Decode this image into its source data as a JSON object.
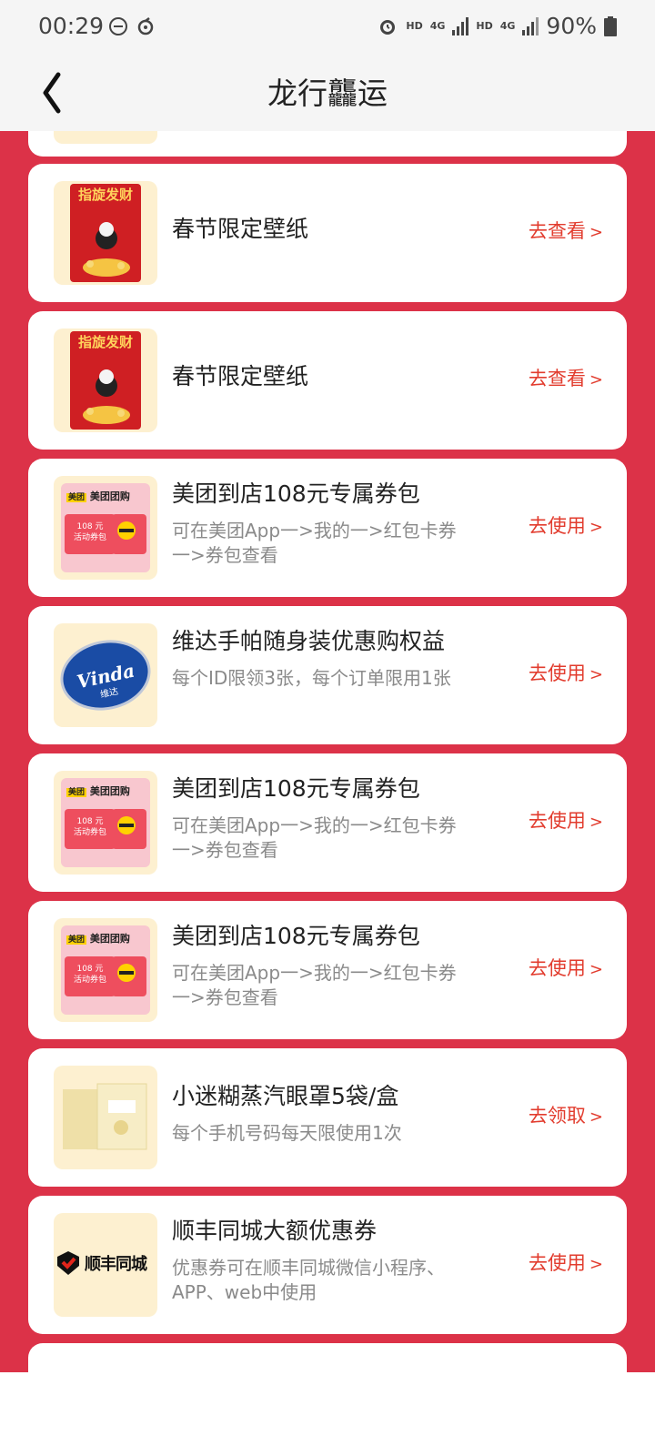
{
  "status_bar": {
    "time": "00:29",
    "network_1": "4G",
    "network_2": "4G",
    "battery": "90%"
  },
  "nav": {
    "title": "龙行龘运"
  },
  "items": [
    {
      "thumb": "red-envelope",
      "envelope_text": "指旋发财",
      "title": "春节限定壁纸",
      "desc": "",
      "action": "去查看",
      "arrow": ">"
    },
    {
      "thumb": "red-envelope",
      "envelope_text": "指旋发财",
      "title": "春节限定壁纸",
      "desc": "",
      "action": "去查看",
      "arrow": ">"
    },
    {
      "thumb": "meituan",
      "title": "美团到店108元专属券包",
      "desc": "可在美团App一>我的一>红包卡券一>券包查看",
      "action": "去使用",
      "arrow": ">"
    },
    {
      "thumb": "vinda",
      "title": "维达手帕随身装优惠购权益",
      "desc": "每个ID限领3张，每个订单限用1张",
      "action": "去使用",
      "arrow": ">"
    },
    {
      "thumb": "meituan",
      "title": "美团到店108元专属券包",
      "desc": "可在美团App一>我的一>红包卡券一>券包查看",
      "action": "去使用",
      "arrow": ">"
    },
    {
      "thumb": "meituan",
      "title": "美团到店108元专属券包",
      "desc": "可在美团App一>我的一>红包卡券一>券包查看",
      "action": "去使用",
      "arrow": ">"
    },
    {
      "thumb": "eye-mask",
      "title": "小迷糊蒸汽眼罩5袋/盒",
      "desc": "每个手机号码每天限使用1次",
      "action": "去领取",
      "arrow": ">"
    },
    {
      "thumb": "sf",
      "title": "顺丰同城大额优惠券",
      "desc": "优惠券可在顺丰同城微信小程序、APP、web中使用",
      "action": "去使用",
      "arrow": ">"
    }
  ],
  "thumb_text": {
    "meituan_brand": "美团团购",
    "meituan_badge": "美团",
    "meituan_amount": "108 元",
    "meituan_label": "活动券包",
    "vinda_brand": "Vinda",
    "vinda_cn": "维达",
    "sf_brand": "顺丰同城"
  },
  "colors": {
    "page_bg": "#dc3248",
    "action": "#e23c2e",
    "thumb_bg": "#fdf0d0"
  }
}
